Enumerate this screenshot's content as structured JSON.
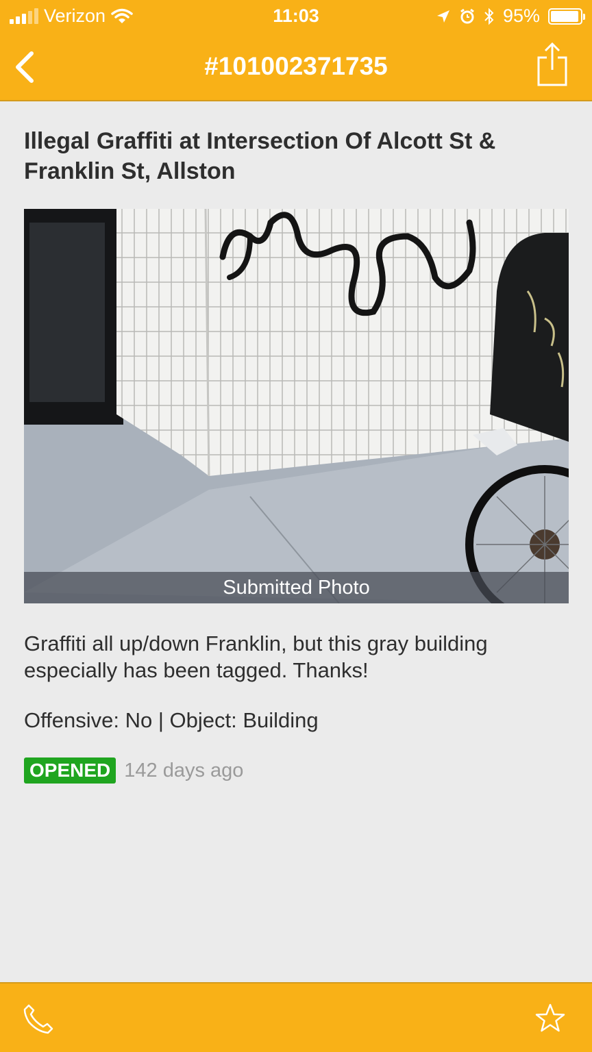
{
  "status_bar": {
    "carrier": "Verizon",
    "time": "11:03",
    "battery": "95%",
    "battery_level": 0.95
  },
  "header": {
    "title": "#101002371735",
    "back_icon": "chevron-left-icon",
    "share_icon": "share-icon"
  },
  "report": {
    "title": "Illegal Graffiti at Intersection Of Alcott St & Franklin St, Allston",
    "photo_caption": "Submitted Photo",
    "description": "Graffiti all up/down Franklin, but this gray building especially has been tagged. Thanks!",
    "meta": "Offensive: No | Object: Building",
    "status": "OPENED",
    "age": "142 days ago"
  },
  "footer": {
    "phone_icon": "phone-icon",
    "star_icon": "star-icon"
  },
  "colors": {
    "accent": "#f9b117",
    "badge_green": "#1fa51f",
    "background": "#ebebeb"
  }
}
